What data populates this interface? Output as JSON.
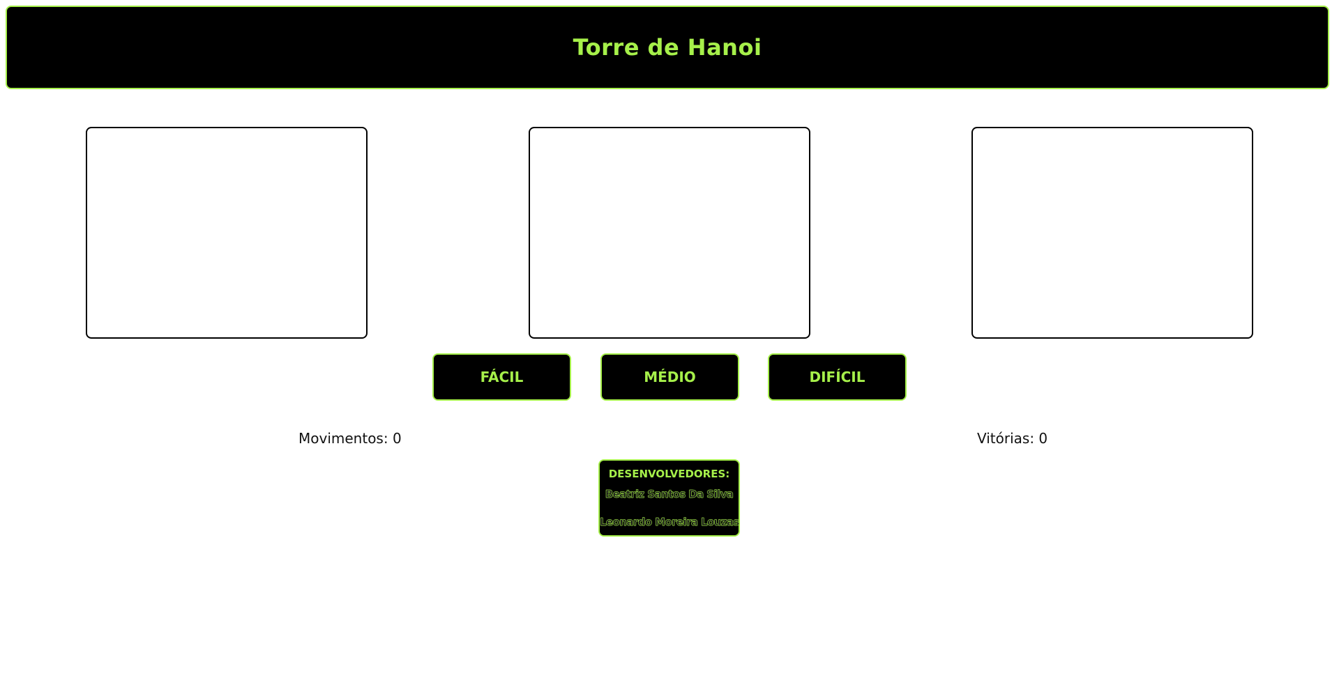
{
  "header": {
    "title": "Torre de Hanoi"
  },
  "towers": [
    {
      "id": "tower-1",
      "discs": []
    },
    {
      "id": "tower-2",
      "discs": []
    },
    {
      "id": "tower-3",
      "discs": []
    }
  ],
  "difficulty": {
    "easy_label": "FÁCIL",
    "medium_label": "MÉDIO",
    "hard_label": "DIFÍCIL"
  },
  "stats": {
    "moves_label": "Movimentos: 0",
    "wins_label": "Vitórias: 0"
  },
  "credits": {
    "title": "DESENVOLVEDORES:",
    "developers": [
      "Beatriz Santos Da Silva",
      "Leonardo Moreira Louzas"
    ]
  },
  "colors": {
    "accent": "#a6f04a",
    "panel": "#000000",
    "background": "#ffffff"
  }
}
